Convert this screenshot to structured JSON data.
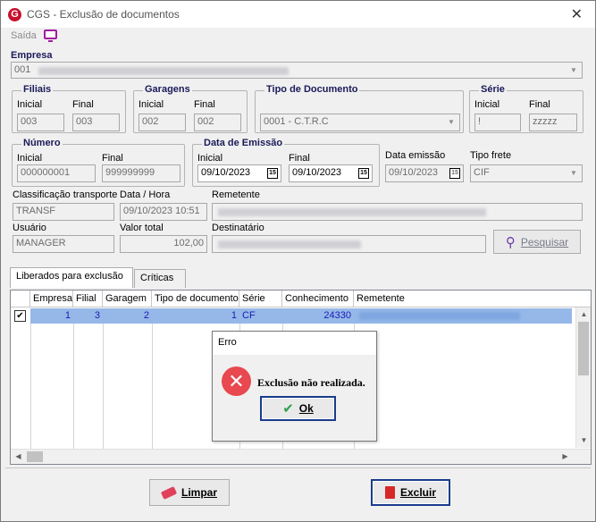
{
  "window": {
    "title": "CGS - Exclusão de documentos",
    "logo_letter": "G",
    "close_glyph": "✕"
  },
  "menu": {
    "saida_label": "Saída"
  },
  "empresa": {
    "label": "Empresa",
    "value": "001"
  },
  "filiais": {
    "group": "Filiais",
    "inicial_label": "Inicial",
    "final_label": "Final",
    "inicial": "003",
    "final": "003"
  },
  "garagens": {
    "group": "Garagens",
    "inicial_label": "Inicial",
    "final_label": "Final",
    "inicial": "002",
    "final": "002"
  },
  "tipo_documento": {
    "group": "Tipo de Documento",
    "value": "0001 - C.T.R.C"
  },
  "serie": {
    "group": "Série",
    "inicial_label": "Inicial",
    "final_label": "Final",
    "inicial": "!",
    "final": "zzzzz"
  },
  "numero": {
    "group": "Número",
    "inicial_label": "Inicial",
    "final_label": "Final",
    "inicial": "000000001",
    "final": "999999999"
  },
  "data_emissao_range": {
    "group": "Data de Emissão",
    "inicial_label": "Inicial",
    "final_label": "Final",
    "inicial": "09/10/2023",
    "final": "09/10/2023"
  },
  "data_emissao": {
    "label": "Data emissão",
    "value": "09/10/2023"
  },
  "tipo_frete": {
    "label": "Tipo frete",
    "value": "CIF"
  },
  "calendar_glyph": "15",
  "classificacao": {
    "label": "Classificação transporte",
    "value": "TRANSF"
  },
  "data_hora": {
    "label": "Data / Hora",
    "value": "09/10/2023 10:51"
  },
  "remetente": {
    "label": "Remetente"
  },
  "usuario": {
    "label": "Usuário",
    "value": "MANAGER"
  },
  "valor_total": {
    "label": "Valor total",
    "value": "102,00"
  },
  "destinatario": {
    "label": "Destinatário"
  },
  "pesquisar_button": "Pesquisar",
  "tabs": [
    {
      "label": "Liberados para exclusão"
    },
    {
      "label": "Críticas"
    }
  ],
  "grid": {
    "headers": [
      "Empresa",
      "Filial",
      "Garagem",
      "Tipo de documento",
      "Série",
      "Conhecimento",
      "Remetente"
    ],
    "rows": [
      {
        "checked": "✔",
        "empresa": "1",
        "filial": "3",
        "garagem": "2",
        "tipo_documento": "1",
        "serie": "CF",
        "conhecimento": "24330"
      }
    ]
  },
  "buttons": {
    "limpar": "Limpar",
    "excluir": "Excluir"
  },
  "dialog": {
    "title": "Erro",
    "message": "Exclusão não realizada.",
    "ok": "Ok",
    "icon_glyph": "✕"
  },
  "colors": {
    "selection": "#95b8e8",
    "error_red": "#e8484f",
    "accent": "#1a3c8c"
  }
}
